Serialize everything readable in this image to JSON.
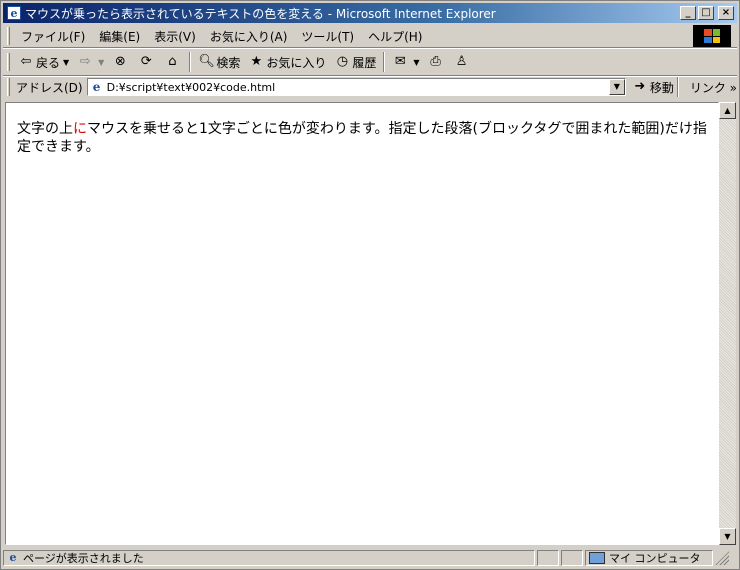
{
  "window": {
    "title": "マウスが乗ったら表示されているテキストの色を変える - Microsoft Internet Explorer",
    "minimize": "_",
    "maximize": "□",
    "close": "×"
  },
  "menu": {
    "items": [
      "ファイル(F)",
      "編集(E)",
      "表示(V)",
      "お気に入り(A)",
      "ツール(T)",
      "ヘルプ(H)"
    ]
  },
  "toolbar": {
    "back_label": "戻る",
    "search_label": "検索",
    "favorites_label": "お気に入り",
    "history_label": "履歴",
    "icons": {
      "back": "back-arrow-icon",
      "forward": "forward-arrow-icon",
      "stop": "stop-icon",
      "refresh": "refresh-icon",
      "home": "home-icon",
      "search": "search-icon",
      "favorites": "favorites-icon",
      "history": "history-icon",
      "mail": "mail-icon",
      "print": "print-icon",
      "messenger": "messenger-icon"
    }
  },
  "address": {
    "label": "アドレス(D)",
    "url": "D:¥script¥text¥002¥code.html",
    "go_label": "移動",
    "links_label": "リンク »"
  },
  "content": {
    "text_before": "文字の上",
    "text_highlight": "に",
    "text_after": "マウスを乗せると1文字ごとに色が変わります。指定した段落(ブロックタグで囲まれた範囲)だけ指定できます。",
    "highlight_color": "#e00000"
  },
  "status": {
    "text": "ページが表示されました",
    "zone": "マイ コンピュータ"
  }
}
